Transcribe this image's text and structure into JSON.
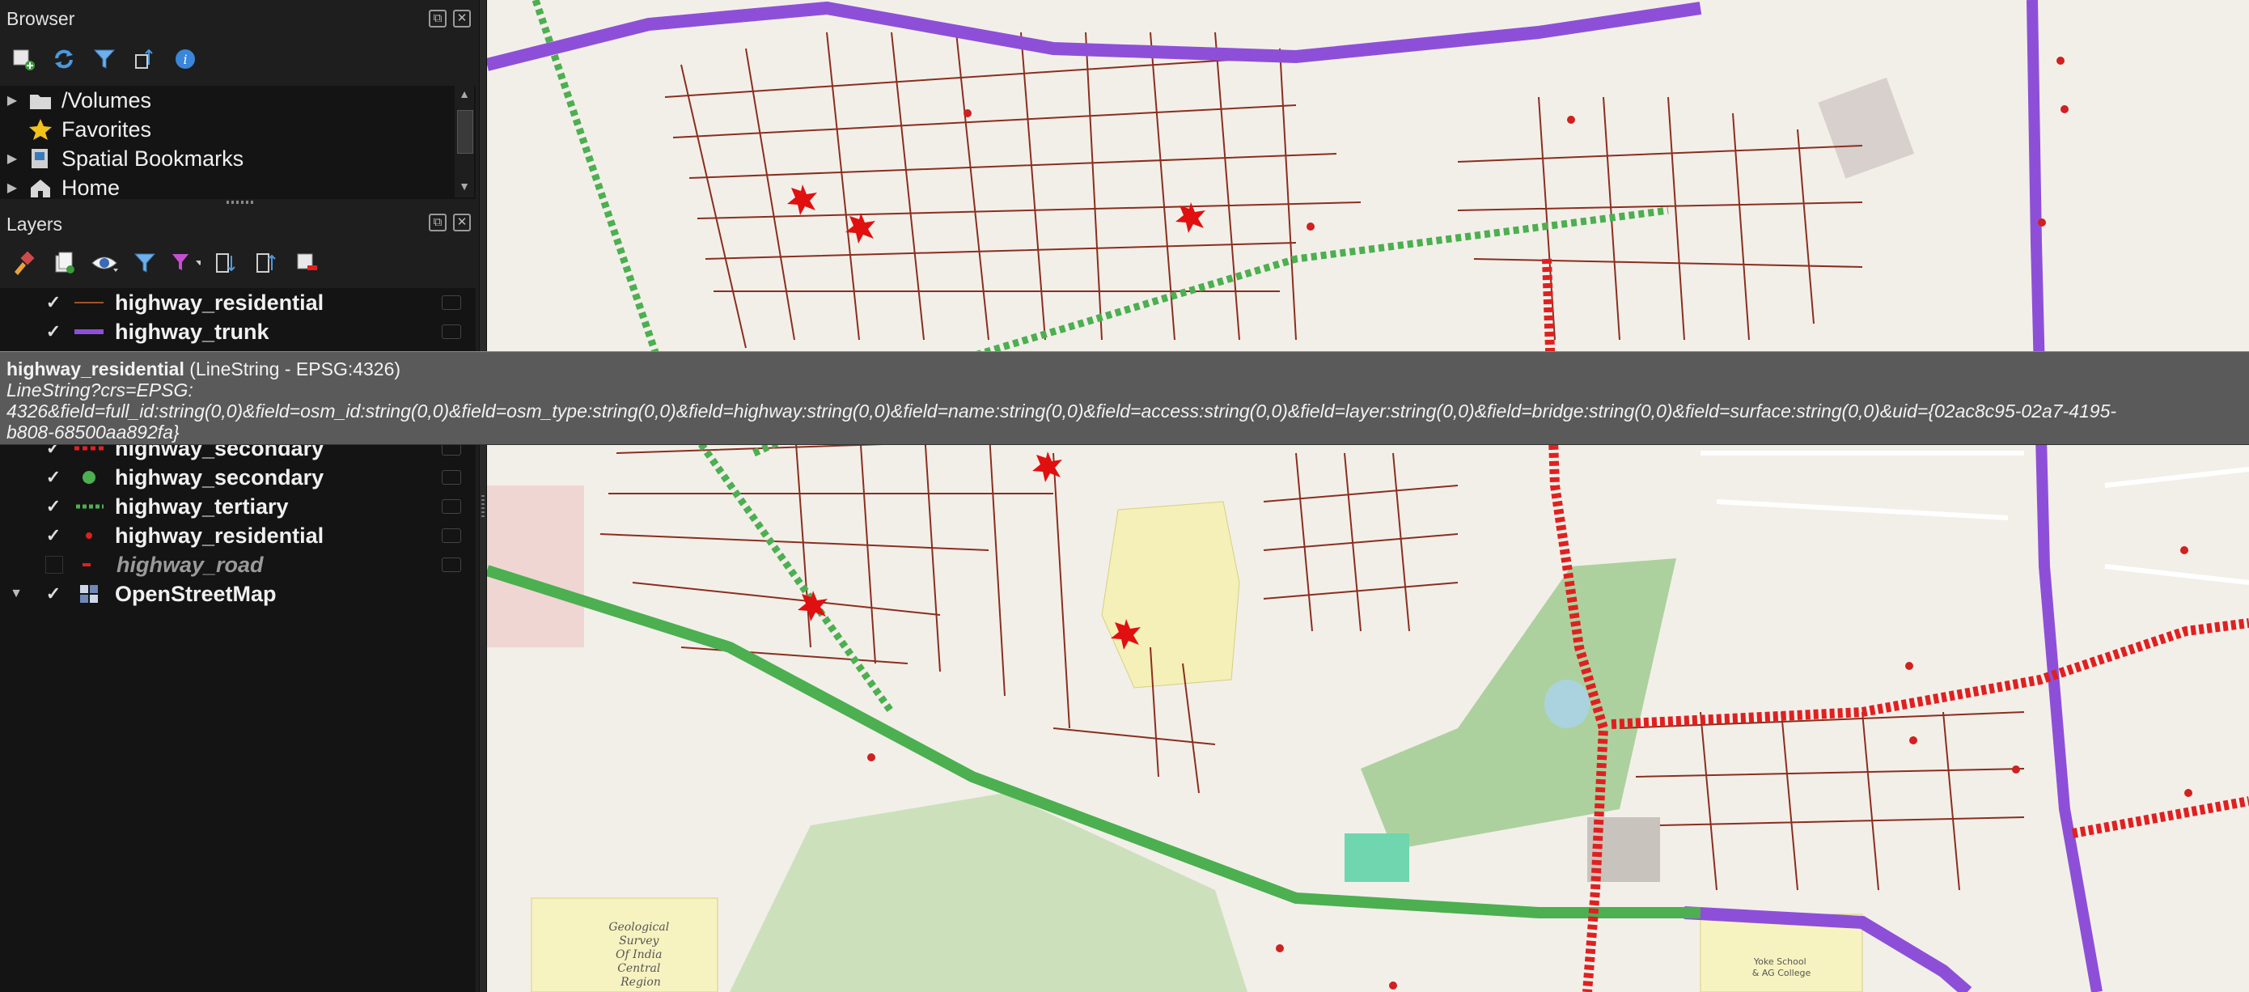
{
  "browser_panel": {
    "title": "Browser",
    "toolbar_icons": [
      "add-layer-icon",
      "refresh-icon",
      "filter-icon",
      "collapse-icon",
      "info-icon"
    ],
    "items": [
      {
        "label": "/Volumes",
        "icon": "folder-icon"
      },
      {
        "label": "Favorites",
        "icon": "star-icon"
      },
      {
        "label": "Spatial Bookmarks",
        "icon": "bookmark-icon"
      },
      {
        "label": "Home",
        "icon": "home-icon"
      }
    ]
  },
  "layers_panel": {
    "title": "Layers",
    "layers": [
      {
        "name": "highway_residential",
        "checked": true,
        "symbol": "line-brown"
      },
      {
        "name": "highway_trunk",
        "checked": true,
        "symbol": "line-purple"
      },
      {
        "name": "highway_secondary",
        "checked": true,
        "symbol": "dash-red"
      },
      {
        "name": "highway_secondary",
        "checked": true,
        "symbol": "dot-green"
      },
      {
        "name": "highway_tertiary",
        "checked": true,
        "symbol": "dots-green"
      },
      {
        "name": "highway_residential",
        "checked": true,
        "symbol": "dot-red"
      },
      {
        "name": "highway_road",
        "checked": false,
        "symbol": "dash-red-small"
      },
      {
        "name": "OpenStreetMap",
        "checked": true,
        "symbol": "raster"
      }
    ]
  },
  "tooltip": {
    "layer_name": "highway_residential",
    "layer_type": "(LineString - EPSG:4326)",
    "source": "LineString?crs=EPSG:\n4326&field=full_id:string(0,0)&field=osm_id:string(0,0)&field=osm_type:string(0,0)&field=highway:string(0,0)&field=name:string(0,0)&field=access:string(0,0)&field=layer:string(0,0)&field=bridge:string(0,0)&field=surface:string(0,0)&uid={02ac8c95-02a7-4195-\nb808-68500aa892fa}"
  },
  "map_labels": {
    "gsi": "Geological\nSurvey\nOf India\nCentral\nRegion",
    "yoke": "Yoke School\n& AG College"
  },
  "colors": {
    "trunk": "#8e4fd8",
    "secondary": "#e02020",
    "tertiary": "#4caf50",
    "residential": "#8b2e1e",
    "map_bg": "#f2efe9"
  }
}
